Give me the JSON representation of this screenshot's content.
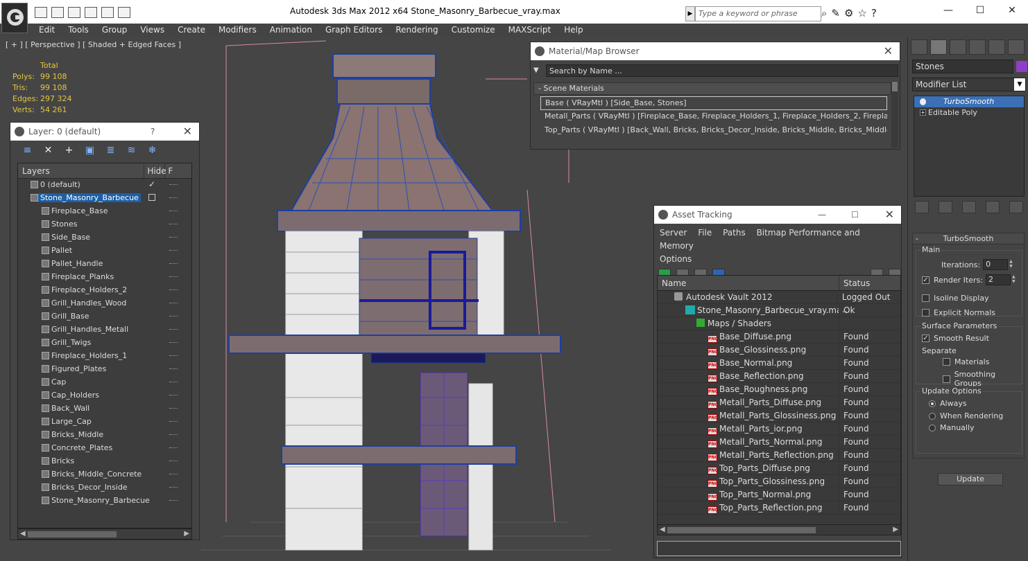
{
  "app": {
    "title": "Autodesk 3ds Max  2012 x64      Stone_Masonry_Barbecue_vray.max",
    "help_placeholder": "Type a keyword or phrase",
    "win_min": "—",
    "win_max": "☐",
    "win_close": "✕"
  },
  "menu": [
    "Edit",
    "Tools",
    "Group",
    "Views",
    "Create",
    "Modifiers",
    "Animation",
    "Graph Editors",
    "Rendering",
    "Customize",
    "MAXScript",
    "Help"
  ],
  "viewport": {
    "label": "[ + ] [ Perspective ] [ Shaded + Edged Faces ]",
    "stats": {
      "total_label": "Total",
      "rows": [
        {
          "k": "Polys:",
          "v": "99 108"
        },
        {
          "k": "Tris:",
          "v": "99 108"
        },
        {
          "k": "Edges:",
          "v": "297 324"
        },
        {
          "k": "Verts:",
          "v": "54 261"
        }
      ]
    }
  },
  "layer_panel": {
    "title": "Layer: 0 (default)",
    "help": "?",
    "close": "✕",
    "col_layers": "Layers",
    "col_hide": "Hide",
    "col_f": "F",
    "layers": [
      {
        "name": "0 (default)",
        "level": "top",
        "checked": true
      },
      {
        "name": "Stone_Masonry_Barbecue",
        "level": "top",
        "selected": true
      },
      {
        "name": "Fireplace_Base"
      },
      {
        "name": "Stones"
      },
      {
        "name": "Side_Base"
      },
      {
        "name": "Pallet"
      },
      {
        "name": "Pallet_Handle"
      },
      {
        "name": "Fireplace_Planks"
      },
      {
        "name": "Fireplace_Holders_2"
      },
      {
        "name": "Grill_Handles_Wood"
      },
      {
        "name": "Grill_Base"
      },
      {
        "name": "Grill_Handles_Metall"
      },
      {
        "name": "Grill_Twigs"
      },
      {
        "name": "Fireplace_Holders_1"
      },
      {
        "name": "Figured_Plates"
      },
      {
        "name": "Cap"
      },
      {
        "name": "Cap_Holders"
      },
      {
        "name": "Back_Wall"
      },
      {
        "name": "Large_Cap"
      },
      {
        "name": "Bricks_Middle"
      },
      {
        "name": "Concrete_Plates"
      },
      {
        "name": "Bricks"
      },
      {
        "name": "Bricks_Middle_Concrete"
      },
      {
        "name": "Bricks_Decor_Inside"
      },
      {
        "name": "Stone_Masonry_Barbecue"
      }
    ]
  },
  "material_browser": {
    "title": "Material/Map Browser",
    "close": "✕",
    "search_placeholder": "Search by Name ...",
    "group": "- Scene Materials",
    "materials": [
      "Base  ( VRayMtl )  [Side_Base, Stones]",
      "Metall_Parts  ( VRayMtl )  [Fireplace_Base, Fireplace_Holders_1, Fireplace_Holders_2, Fireplace...",
      "Top_Parts  ( VRayMtl )  [Back_Wall, Bricks, Bricks_Decor_Inside, Bricks_Middle, Bricks_Middle_..."
    ]
  },
  "asset_tracking": {
    "title": "Asset Tracking",
    "menu": [
      "Server",
      "File",
      "Paths",
      "Bitmap Performance and Memory",
      "Options"
    ],
    "col_name": "Name",
    "col_status": "Status",
    "rows": [
      {
        "name": "Autodesk Vault 2012",
        "status": "Logged Out ...",
        "type": "vault"
      },
      {
        "name": "Stone_Masonry_Barbecue_vray.max",
        "status": "Ok",
        "type": "max"
      },
      {
        "name": "Maps / Shaders",
        "status": "",
        "type": "maps"
      },
      {
        "name": "Base_Diffuse.png",
        "status": "Found",
        "type": "png"
      },
      {
        "name": "Base_Glossiness.png",
        "status": "Found",
        "type": "png"
      },
      {
        "name": "Base_Normal.png",
        "status": "Found",
        "type": "png"
      },
      {
        "name": "Base_Reflection.png",
        "status": "Found",
        "type": "png"
      },
      {
        "name": "Base_Roughness.png",
        "status": "Found",
        "type": "png"
      },
      {
        "name": "Metall_Parts_Diffuse.png",
        "status": "Found",
        "type": "png"
      },
      {
        "name": "Metall_Parts_Glossiness.png",
        "status": "Found",
        "type": "png"
      },
      {
        "name": "Metall_Parts_ior.png",
        "status": "Found",
        "type": "png"
      },
      {
        "name": "Metall_Parts_Normal.png",
        "status": "Found",
        "type": "png"
      },
      {
        "name": "Metall_Parts_Reflection.png",
        "status": "Found",
        "type": "png"
      },
      {
        "name": "Top_Parts_Diffuse.png",
        "status": "Found",
        "type": "png"
      },
      {
        "name": "Top_Parts_Glossiness.png",
        "status": "Found",
        "type": "png"
      },
      {
        "name": "Top_Parts_Normal.png",
        "status": "Found",
        "type": "png"
      },
      {
        "name": "Top_Parts_Reflection.png",
        "status": "Found",
        "type": "png"
      }
    ]
  },
  "command_panel": {
    "object_name": "Stones",
    "object_color": "#8e3ec8",
    "modifier_list": "Modifier List",
    "stack": [
      "TurboSmooth",
      "Editable Poly"
    ],
    "rollout_title": "TurboSmooth",
    "main_label": "Main",
    "iterations_label": "Iterations:",
    "iterations_value": "0",
    "render_iters_label": "Render Iters:",
    "render_iters_value": "2",
    "isoline_label": "Isoline Display",
    "explicit_normals_label": "Explicit Normals",
    "surface_label": "Surface Parameters",
    "smooth_result_label": "Smooth Result",
    "separate_label": "Separate",
    "materials_label": "Materials",
    "smoothing_groups_label": "Smoothing Groups",
    "update_options_label": "Update Options",
    "always_label": "Always",
    "when_rendering_label": "When Rendering",
    "manually_label": "Manually",
    "update_button": "Update"
  }
}
